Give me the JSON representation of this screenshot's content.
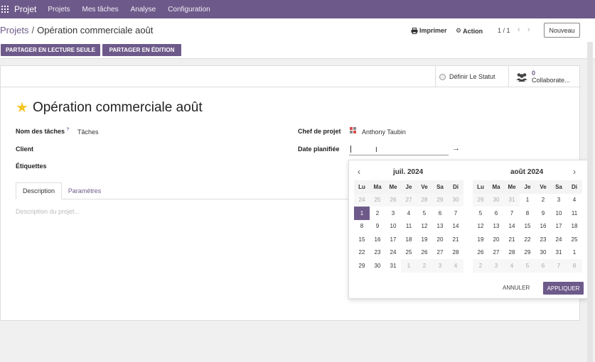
{
  "navbar": {
    "brand": "Projet",
    "items": [
      "Projets",
      "Mes tâches",
      "Analyse",
      "Configuration"
    ]
  },
  "breadcrumb": {
    "parent": "Projets",
    "separator": "/",
    "current": "Opération commerciale août"
  },
  "controls": {
    "print": "Imprimer",
    "action": "Action",
    "pager": "1 / 1",
    "new": "Nouveau"
  },
  "share": {
    "readonly": "PARTAGER EN LECTURE SEULE",
    "edit": "PARTAGER EN ÉDITION"
  },
  "status": {
    "set_status": "Définir Le Statut",
    "collab_count": "0",
    "collab_label": "Collaborate..."
  },
  "form": {
    "title": "Opération commerciale août",
    "task_name_label": "Nom des tâches",
    "task_name_help": "?",
    "task_name_value": "Tâches",
    "client_label": "Client",
    "tags_label": "Étiquettes",
    "manager_label": "Chef de projet",
    "manager_value": "Anthony Taubin",
    "planned_date_label": "Date planifiée",
    "arrow": "→"
  },
  "tabs": {
    "description": "Description",
    "parameters": "Paramètres"
  },
  "description_placeholder": "Description du projet...",
  "datepicker": {
    "prev": "‹",
    "next": "›",
    "weekdays": [
      "Lu",
      "Ma",
      "Me",
      "Je",
      "Ve",
      "Sa",
      "Di"
    ],
    "months": [
      {
        "title": "juil. 2024",
        "days": [
          "24",
          "25",
          "26",
          "27",
          "28",
          "29",
          "30",
          "1",
          "2",
          "3",
          "4",
          "5",
          "6",
          "7",
          "8",
          "9",
          "10",
          "11",
          "12",
          "13",
          "14",
          "15",
          "16",
          "17",
          "18",
          "19",
          "20",
          "21",
          "22",
          "23",
          "24",
          "25",
          "26",
          "27",
          "28",
          "29",
          "30",
          "31",
          "1",
          "2",
          "3",
          "4"
        ],
        "muted": [
          0,
          1,
          2,
          3,
          4,
          5,
          6,
          38,
          39,
          40,
          41
        ],
        "selected": [
          7
        ]
      },
      {
        "title": "août 2024",
        "days": [
          "29",
          "30",
          "31",
          "1",
          "2",
          "3",
          "4",
          "5",
          "6",
          "7",
          "8",
          "9",
          "10",
          "11",
          "12",
          "13",
          "14",
          "15",
          "16",
          "17",
          "18",
          "19",
          "20",
          "21",
          "22",
          "23",
          "24",
          "25",
          "26",
          "27",
          "28",
          "29",
          "30",
          "31",
          "1",
          "2",
          "3",
          "4",
          "5",
          "6",
          "7",
          "8"
        ],
        "muted": [
          0,
          1,
          2,
          35,
          36,
          37,
          38,
          39,
          40,
          41
        ],
        "selected": []
      }
    ],
    "cancel": "ANNULER",
    "apply": "APPLIQUER"
  },
  "colors": {
    "brand": "#6e5a8a",
    "star": "#f3c623"
  }
}
